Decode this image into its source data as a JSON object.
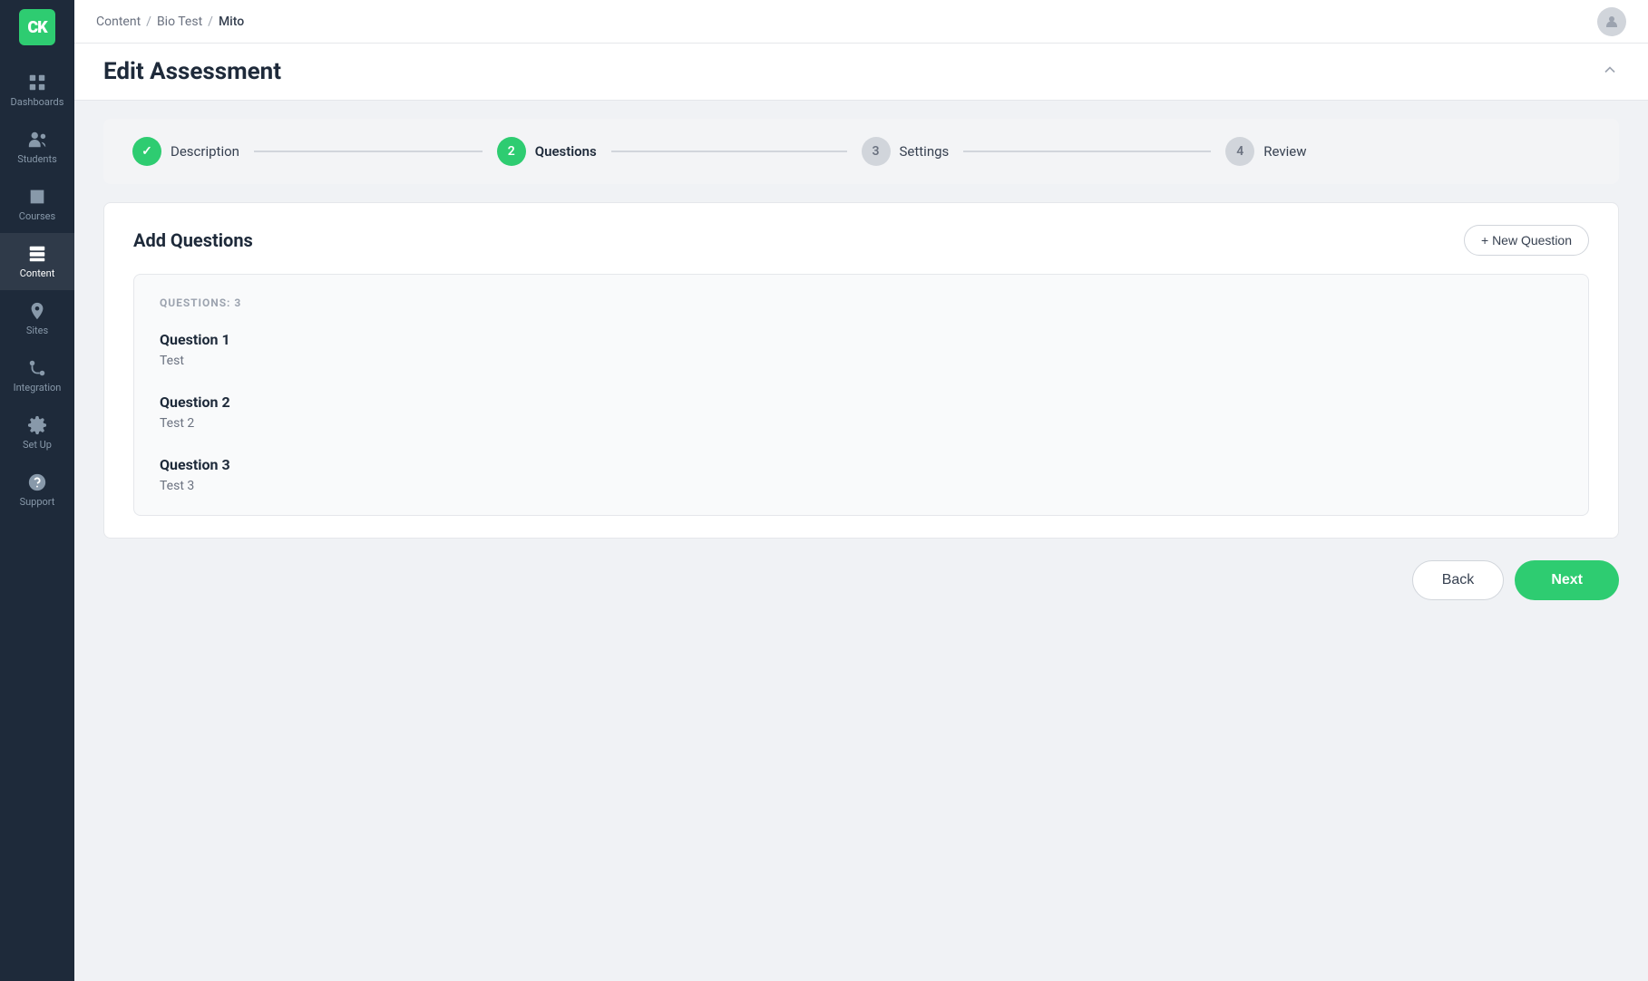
{
  "sidebar": {
    "logo": "CK",
    "items": [
      {
        "id": "dashboards",
        "label": "Dashboards",
        "icon": "grid"
      },
      {
        "id": "students",
        "label": "Students",
        "icon": "users"
      },
      {
        "id": "courses",
        "label": "Courses",
        "icon": "book"
      },
      {
        "id": "content",
        "label": "Content",
        "icon": "layers",
        "active": true
      },
      {
        "id": "sites",
        "label": "Sites",
        "icon": "pin"
      },
      {
        "id": "integration",
        "label": "Integration",
        "icon": "integration"
      },
      {
        "id": "setup",
        "label": "Set Up",
        "icon": "gear"
      },
      {
        "id": "support",
        "label": "Support",
        "icon": "question"
      }
    ]
  },
  "topbar": {
    "breadcrumb": [
      "Content",
      "Bio Test",
      "Mito"
    ]
  },
  "page": {
    "title": "Edit Assessment",
    "steps": [
      {
        "id": "description",
        "label": "Description",
        "state": "done",
        "number": "✓"
      },
      {
        "id": "questions",
        "label": "Questions",
        "state": "active",
        "number": "2"
      },
      {
        "id": "settings",
        "label": "Settings",
        "state": "inactive",
        "number": "3"
      },
      {
        "id": "review",
        "label": "Review",
        "state": "inactive",
        "number": "4"
      }
    ],
    "add_questions_title": "Add Questions",
    "new_question_label": "+ New Question",
    "questions_count_label": "QUESTIONS: 3",
    "questions": [
      {
        "id": 1,
        "name": "Question 1",
        "text": "Test"
      },
      {
        "id": 2,
        "name": "Question 2",
        "text": "Test 2"
      },
      {
        "id": 3,
        "name": "Question 3",
        "text": "Test 3"
      }
    ],
    "back_label": "Back",
    "next_label": "Next"
  }
}
